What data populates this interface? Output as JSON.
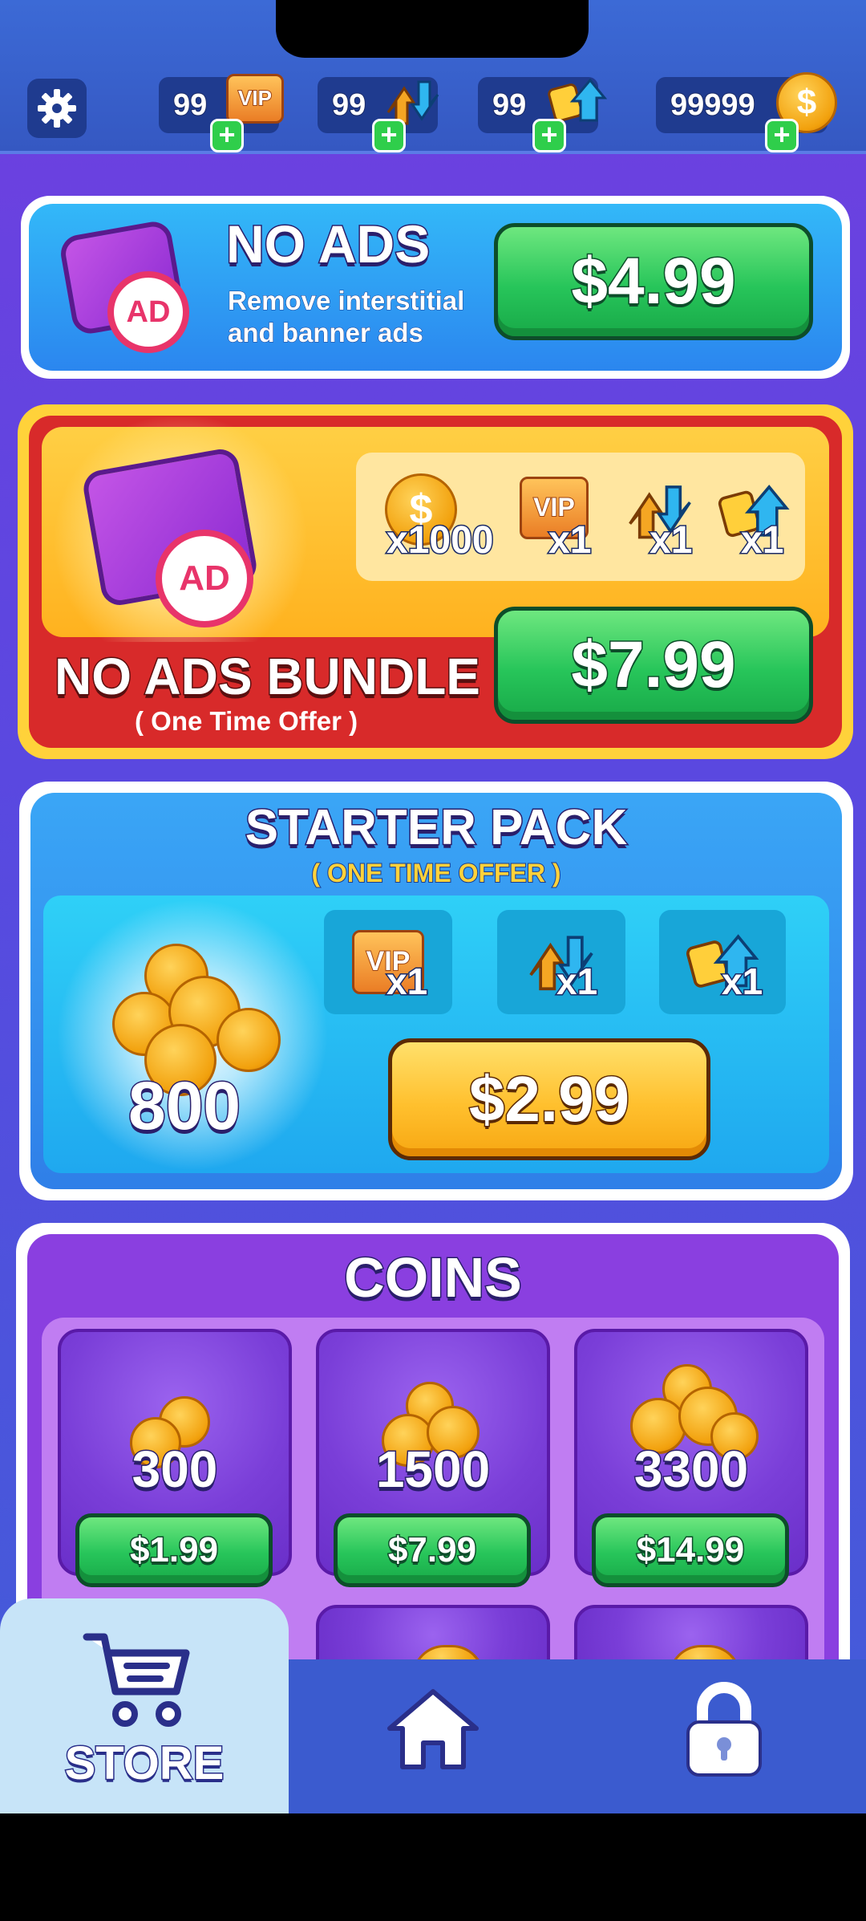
{
  "topbar": {
    "resources": [
      {
        "name": "vip",
        "value": "99",
        "icon": "vip-ticket-icon"
      },
      {
        "name": "undo",
        "value": "99",
        "icon": "undo-arrows-icon"
      },
      {
        "name": "shuffle",
        "value": "99",
        "icon": "shuffle-cards-icon"
      },
      {
        "name": "coins",
        "value": "99999",
        "icon": "coin-icon"
      }
    ],
    "vip_chip_label": "VIP",
    "coin_symbol": "$",
    "plus_label": "+"
  },
  "no_ads": {
    "title": "NO ADS",
    "description_line1": "Remove interstitial",
    "description_line2": "and banner ads",
    "price": "$4.99",
    "badge_text": "AD"
  },
  "bundle": {
    "title": "NO ADS BUNDLE",
    "subtitle": "( One Time Offer )",
    "price": "$7.99",
    "badge_text": "AD",
    "items": [
      {
        "icon": "coin-icon",
        "qty": "x1000"
      },
      {
        "icon": "vip-ticket-icon",
        "qty": "x1",
        "label": "VIP"
      },
      {
        "icon": "undo-arrows-icon",
        "qty": "x1"
      },
      {
        "icon": "shuffle-cards-icon",
        "qty": "x1"
      }
    ]
  },
  "starter": {
    "title": "STARTER PACK",
    "subtitle": "( ONE TIME OFFER )",
    "coin_amount": "800",
    "price": "$2.99",
    "items": [
      {
        "icon": "vip-ticket-icon",
        "qty": "x1",
        "label": "VIP"
      },
      {
        "icon": "undo-arrows-icon",
        "qty": "x1"
      },
      {
        "icon": "shuffle-cards-icon",
        "qty": "x1"
      }
    ]
  },
  "coins": {
    "title": "COINS",
    "packs": [
      {
        "amount": "300",
        "price": "$1.99"
      },
      {
        "amount": "1500",
        "price": "$7.99"
      },
      {
        "amount": "3300",
        "price": "$14.99"
      }
    ]
  },
  "nav": {
    "store_label": "STORE",
    "active": "store"
  },
  "colors": {
    "accent_green": "#27c55a",
    "accent_yellow": "#ffc02e",
    "bundle_red": "#d82a2a",
    "card_blue": "#2a8ff0",
    "coins_purple": "#7a3ed8"
  }
}
